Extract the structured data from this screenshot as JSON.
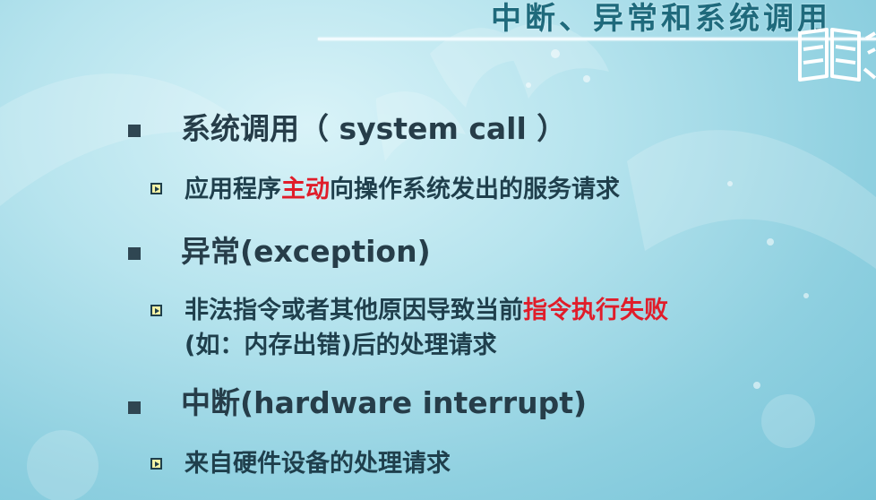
{
  "slide": {
    "title": "中断、异常和系统调用",
    "sections": [
      {
        "heading": "系统调用（ system call ）",
        "detail": {
          "before": "应用程序",
          "highlight": "主动",
          "after": "向操作系统发出的服务请求"
        }
      },
      {
        "heading": "异常(exception)",
        "detail": {
          "before": "非法指令或者其他原因导致当前",
          "highlight": "指令执行失败",
          "line2": "(如：内存出错)后的处理请求"
        }
      },
      {
        "heading": "中断(hardware interrupt)",
        "detail": {
          "text": "来自硬件设备的处理请求"
        }
      }
    ]
  },
  "colors": {
    "heading": "#263d49",
    "detail": "#1f3f4c",
    "highlight": "#e01d2a",
    "title": "#1f6a7c"
  },
  "icons": {
    "logo": "book-logo-icon"
  }
}
